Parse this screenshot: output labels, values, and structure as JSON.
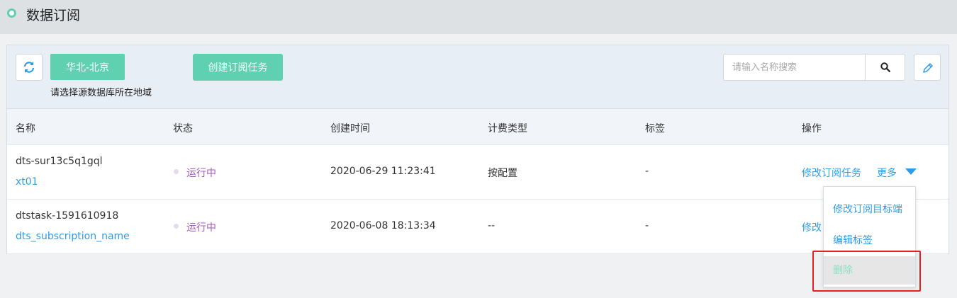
{
  "header": {
    "title": "数据订阅"
  },
  "toolbar": {
    "region_button": "华北-北京",
    "region_hint": "请选择源数据库所在地域",
    "create_button": "创建订阅任务",
    "search_placeholder": "请输入名称搜索"
  },
  "table": {
    "columns": [
      "名称",
      "状态",
      "创建时间",
      "计费类型",
      "标签",
      "操作"
    ],
    "rows": [
      {
        "id": "dts-sur13c5q1gql",
        "name": "xt01",
        "status": "运行中",
        "created": "2020-06-29 11:23:41",
        "billing": "按配置",
        "tag": "-",
        "action_modify": "修改订阅任务",
        "action_more": "更多"
      },
      {
        "id": "dtstask-1591610918",
        "name": "dts_subscription_name",
        "status": "运行中",
        "created": "2020-06-08 18:13:34",
        "billing": "--",
        "tag": "-",
        "action_modify": "修改"
      }
    ]
  },
  "dropdown": {
    "items": [
      "修改订阅目标端",
      "编辑标签",
      "删除"
    ]
  },
  "colors": {
    "accent": "#5fd0b0",
    "link": "#2d9ce8",
    "status": "#a35ab8",
    "highlight": "#e32222"
  }
}
